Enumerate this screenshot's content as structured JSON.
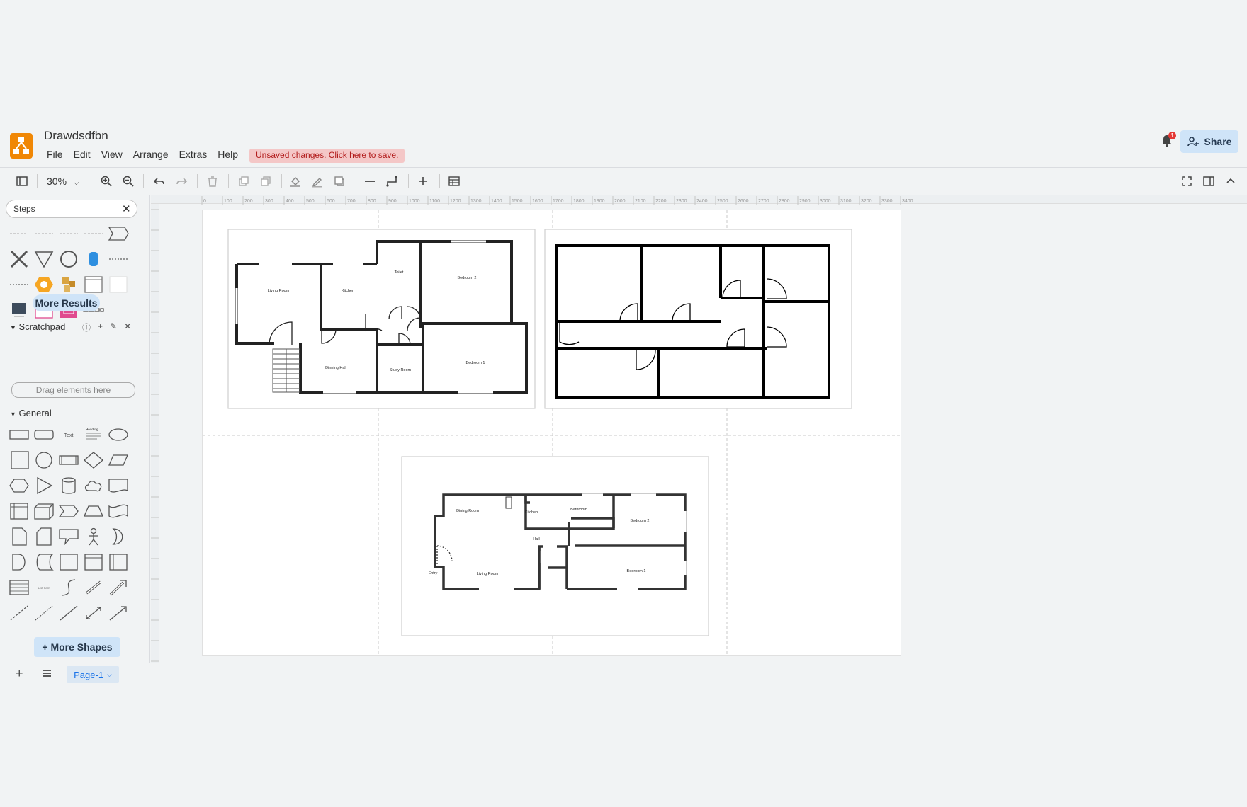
{
  "app": {
    "title": "Drawdsdfbn",
    "menu": [
      "File",
      "Edit",
      "View",
      "Arrange",
      "Extras",
      "Help"
    ],
    "unsaved_notice": "Unsaved changes. Click here to save.",
    "share_label": "Share",
    "notification_count": "1",
    "brand_color": "#f08705"
  },
  "toolbar": {
    "zoom": "30%"
  },
  "sidebar": {
    "search_value": "Steps",
    "more_results_label": "More Results",
    "scratchpad_label": "Scratchpad",
    "scratchpad_drop_text": "Drag elements here",
    "general_label": "General",
    "more_shapes_label": "+ More Shapes",
    "shape_text_label": "Text",
    "shape_heading_label": "Heading",
    "shape_list_label": "List Item"
  },
  "ruler": {
    "ticks": [
      "0",
      "100",
      "200",
      "300",
      "400",
      "500",
      "600",
      "700",
      "800",
      "900",
      "1000",
      "1100",
      "1200",
      "1300",
      "1400",
      "1500",
      "1600",
      "1700",
      "1800",
      "1900",
      "2000",
      "2100",
      "2200",
      "2300",
      "2400",
      "2500",
      "2600",
      "2700",
      "2800",
      "2900",
      "3000",
      "3100",
      "3200",
      "3300",
      "3400"
    ]
  },
  "floorplan1": {
    "rooms": [
      "Living Room",
      "Kitchen",
      "Toilet",
      "Bedroom 2",
      "Dinning Hall",
      "Study Room",
      "Bedroom 1"
    ]
  },
  "floorplan3": {
    "rooms": [
      "Dining Room",
      "Kitchen",
      "Bathroom",
      "Bedroom 2",
      "Hall",
      "Entry",
      "Living Room",
      "Bedroom 1"
    ]
  },
  "footer": {
    "page_tab": "Page-1"
  }
}
